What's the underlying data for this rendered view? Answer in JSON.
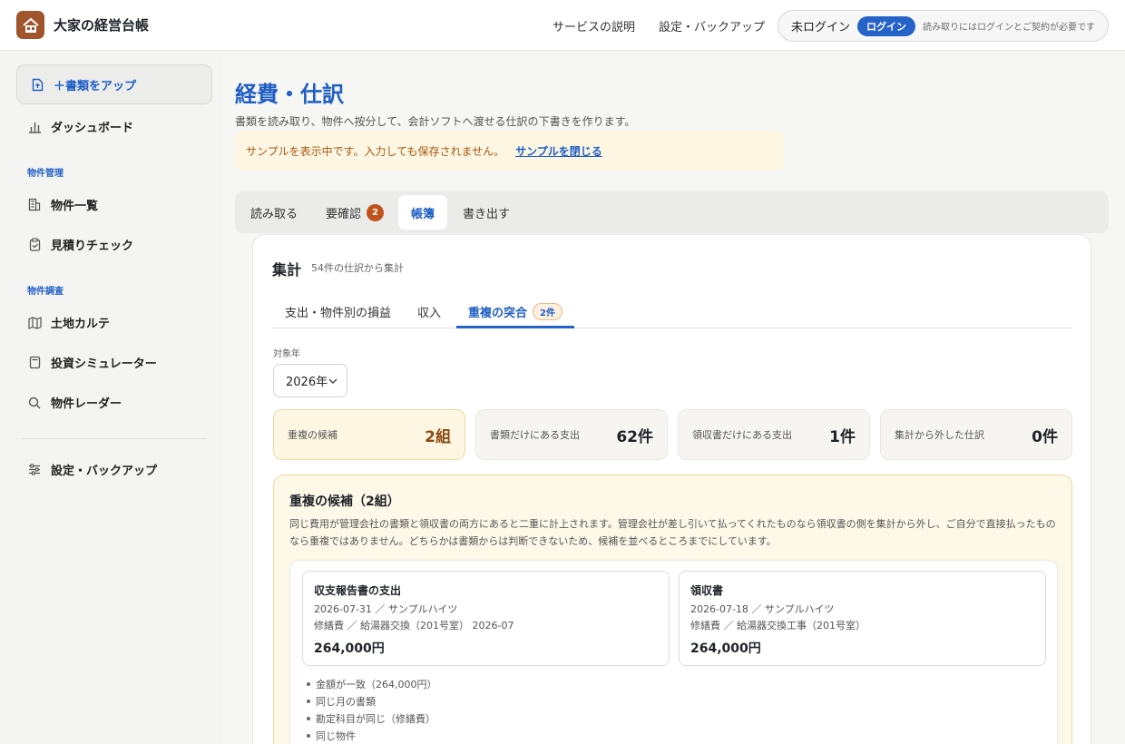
{
  "header": {
    "brand_name": "大家の経営台帳",
    "nav": [
      "サービスの説明",
      "設定・バックアップ"
    ],
    "login_status": "未ログイン",
    "login_button": "ログイン",
    "login_note": "読み取りにはログインとご契約が必要です"
  },
  "sidebar": {
    "upload_label": "＋書類をアップ",
    "dashboard_label": "ダッシュボード",
    "section_property": "物件管理",
    "property_list_label": "物件一覧",
    "estimate_check_label": "見積りチェック",
    "section_research": "物件調査",
    "land_chart_label": "土地カルテ",
    "simulator_label": "投資シミュレーター",
    "radar_label": "物件レーダー",
    "settings_label": "設定・バックアップ"
  },
  "main": {
    "title": "経費・仕訳",
    "description": "書類を読み取り、物件へ按分して、会計ソフトへ渡せる仕訳の下書きを作ります。",
    "sample_text": "サンプルを表示中です。入力しても保存されません。",
    "sample_close": "サンプルを閉じる",
    "tabs": [
      {
        "label": "読み取る"
      },
      {
        "label": "要確認",
        "badge": "2"
      },
      {
        "label": "帳簿"
      },
      {
        "label": "書き出す"
      }
    ],
    "active_tab": "帳簿"
  },
  "summary": {
    "title": "集計",
    "subtitle": "54件の仕訳から集計",
    "subtabs": [
      {
        "label": "支出・物件別の損益"
      },
      {
        "label": "収入"
      },
      {
        "label": "重複の突合",
        "count": "2件"
      }
    ],
    "year_label": "対象年",
    "year_value": "2026年",
    "stats": [
      {
        "label": "重複の候補",
        "value": "2組"
      },
      {
        "label": "書類だけにある支出",
        "value": "62件"
      },
      {
        "label": "領収書だけにある支出",
        "value": "1件"
      },
      {
        "label": "集計から外した仕訳",
        "value": "0件"
      }
    ]
  },
  "duplicates": {
    "title": "重複の候補（2組）",
    "description": "同じ費用が管理会社の書類と領収書の両方にあると二重に計上されます。管理会社が差し引いて払ってくれたものなら領収書の側を集計から外し、ご自分で直接払ったものなら重複ではありません。どちらかは書類からは判断できないため、候補を並べるところまでにしています。",
    "pair": {
      "left": {
        "title": "収支報告書の支出",
        "line1": "2026-07-31 ／ サンプルハイツ",
        "line2": "修繕費 ／ 給湯器交換（201号室） 2026-07",
        "amount": "264,000円"
      },
      "right": {
        "title": "領収書",
        "line1": "2026-07-18 ／ サンプルハイツ",
        "line2": "修繕費 ／ 給湯器交換工事（201号室）",
        "amount": "264,000円"
      },
      "reasons": [
        "金額が一致（264,000円）",
        "同じ月の書類",
        "勘定科目が同じ（修繕費）",
        "同じ物件"
      ]
    }
  },
  "colors": {
    "accent": "#2563c9",
    "brand": "#a0552c",
    "badge": "#c1531a",
    "warning_bg": "#fdf6e2"
  }
}
